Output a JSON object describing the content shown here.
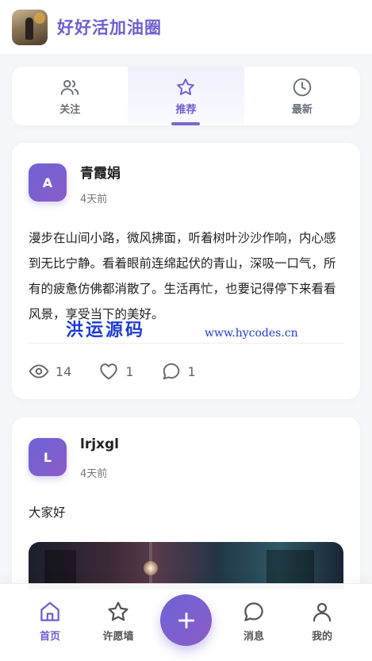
{
  "app": {
    "title": "好好活加油圈"
  },
  "tabs": [
    {
      "label": "关注",
      "icon": "users-icon",
      "active": false
    },
    {
      "label": "推荐",
      "icon": "star-icon",
      "active": true
    },
    {
      "label": "最新",
      "icon": "clock-icon",
      "active": false
    }
  ],
  "posts": [
    {
      "avatar_letter": "A",
      "username": "青霞娟",
      "time": "4天前",
      "content": "漫步在山间小路，微风拂面，听着树叶沙沙作响，内心感到无比宁静。看着眼前连绵起伏的青山，深吸一口气，所有的疲惫仿佛都消散了。生活再忙，也要记得停下来看看风景，享受当下的美好。",
      "views": "14",
      "likes": "1",
      "comments": "1"
    },
    {
      "avatar_letter": "L",
      "username": "lrjxgl",
      "time": "4天前",
      "content": "大家好"
    }
  ],
  "watermark": {
    "text": "洪运源码",
    "url": "www.hycodes.cn"
  },
  "bottom_nav": [
    {
      "label": "首页",
      "icon": "home-icon",
      "active": true
    },
    {
      "label": "许愿墙",
      "icon": "star-icon",
      "active": false
    },
    {
      "label": "消息",
      "icon": "message-icon",
      "active": false
    },
    {
      "label": "我的",
      "icon": "user-icon",
      "active": false
    }
  ],
  "colors": {
    "accent": "#6e5fd0",
    "background": "#f5f6fa",
    "watermark": "#1e3bd6"
  }
}
